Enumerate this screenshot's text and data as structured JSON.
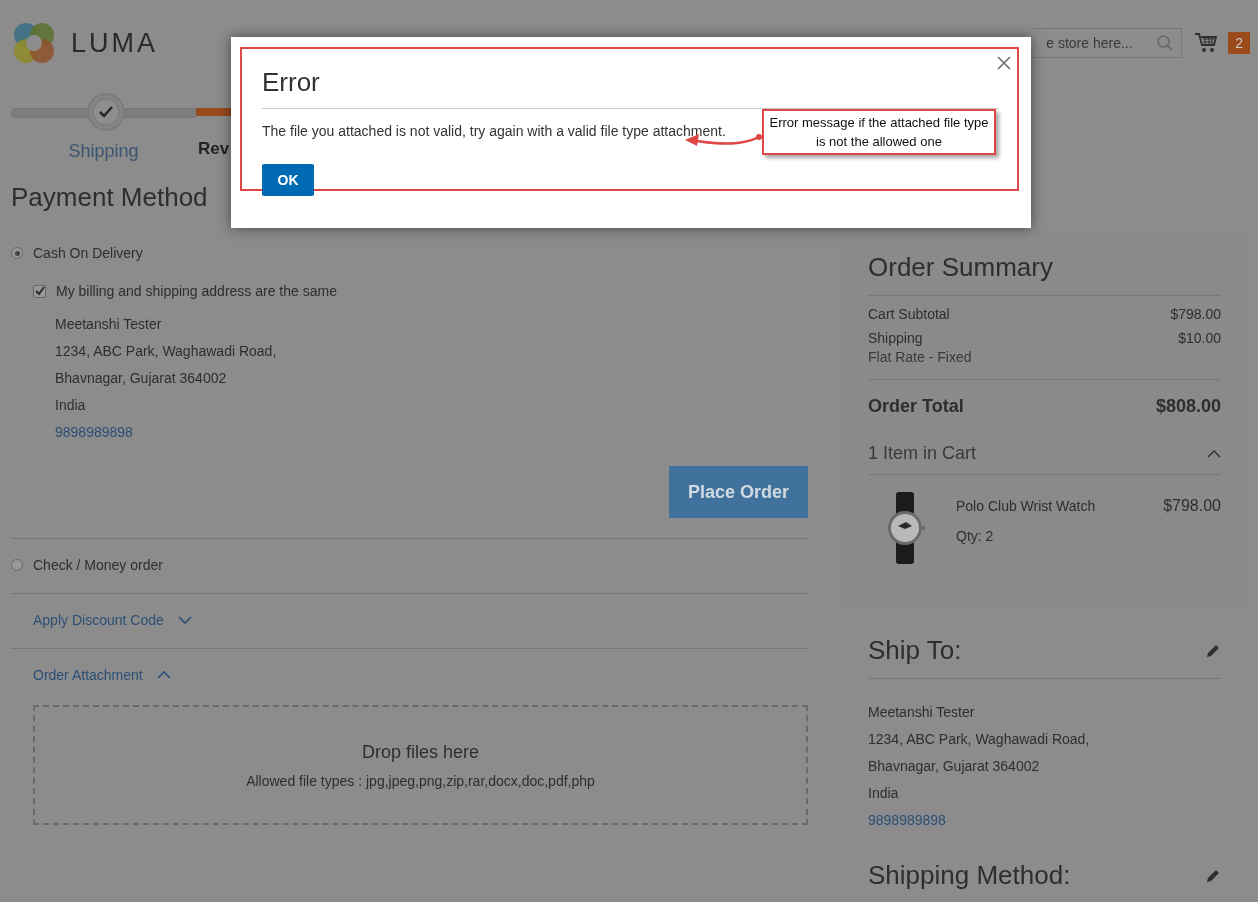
{
  "header": {
    "logo": "LUMA",
    "search": {
      "placeholder": "e store here..."
    },
    "cart_count": "2"
  },
  "progress": {
    "steps": [
      {
        "label": "Shipping",
        "kind": "done"
      },
      {
        "label": "Rev",
        "kind": "active"
      }
    ]
  },
  "payment": {
    "title": "Payment Method",
    "methods": [
      {
        "label": "Cash On Delivery",
        "selected": true,
        "same_address": {
          "label": "My billing and shipping address are the same",
          "checked": true
        },
        "address": [
          "Meetanshi Tester",
          "1234, ABC Park, Waghawadi Road,",
          "Bhavnagar, Gujarat 364002",
          "India"
        ],
        "phone": "9898989898",
        "button": "Place Order"
      },
      {
        "label": "Check / Money order",
        "selected": false
      }
    ]
  },
  "discount": {
    "label": "Apply Discount Code",
    "expanded": false
  },
  "attachment": {
    "label": "Order Attachment",
    "expanded": true,
    "drop_title": "Drop files here",
    "allowed": "Allowed file types : jpg,jpeg,png,zip,rar,docx,doc,pdf,php"
  },
  "summary": {
    "title": "Order Summary",
    "rows": [
      {
        "label": "Cart Subtotal",
        "value": "$798.00"
      },
      {
        "label": "Shipping",
        "sub": "Flat Rate - Fixed",
        "value": "$10.00"
      }
    ],
    "total": {
      "label": "Order Total",
      "value": "$808.00"
    },
    "items_heading": "1 Item in Cart",
    "items_expanded": true,
    "items": [
      {
        "name": "Polo Club Wrist Watch",
        "qty": "Qty: 2",
        "price": "$798.00"
      }
    ]
  },
  "ship_to": {
    "title": "Ship To:",
    "address": [
      "Meetanshi Tester",
      "1234, ABC Park, Waghawadi Road,",
      "Bhavnagar, Gujarat 364002",
      "India"
    ],
    "phone": "9898989898"
  },
  "shipping_method": {
    "title": "Shipping Method:"
  },
  "modal": {
    "title": "Error",
    "message": "The file you attached is not valid, try again with a valid file type attachment.",
    "button": "OK"
  },
  "annotation": {
    "text": "Error message if the attached file type is not the allowed one"
  }
}
